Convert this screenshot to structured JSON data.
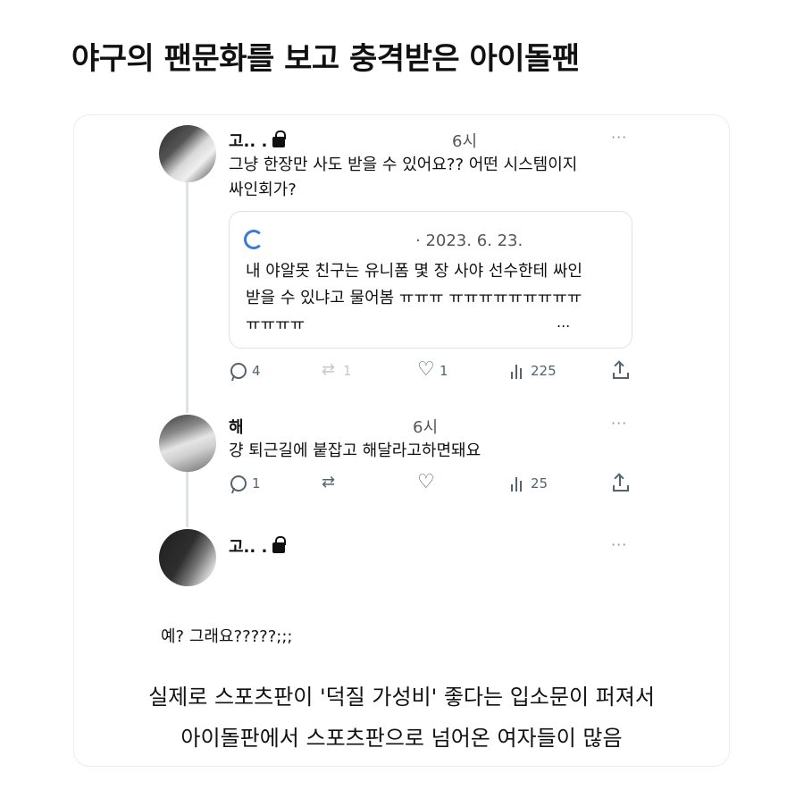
{
  "post": {
    "title": "야구의 팬문화를 보고 충격받은 아이돌팬"
  },
  "tweets": [
    {
      "name": "고.. .",
      "time": "6시",
      "more": "···",
      "text_lines": [
        "그냥 한장만 사도 받을 수 있어요?? 어떤 시스템이지",
        "싸인회가?"
      ],
      "quote": {
        "date": "· 2023. 6. 23.",
        "text_lines": [
          "내 야알못 친구는 유니폼 몇 장 사야 선수한테 싸인",
          "받을 수 있냐고 물어봄 ㅠㅠㅠ ㅠㅠㅠㅠㅠㅠㅠㅠㅠ",
          "ㅠㅠㅠㅠ"
        ],
        "more": "..."
      },
      "actions": {
        "replies": "4",
        "retweets": "1",
        "likes": "1",
        "views": "225"
      }
    },
    {
      "name": "해",
      "time": "6시",
      "more": "···",
      "text_lines": [
        "걍 퇴근길에 붙잡고 해달라고하면돼요"
      ],
      "actions": {
        "replies": "1",
        "retweets": "",
        "likes": "",
        "views": "25"
      }
    },
    {
      "name": "고.. .",
      "more": "···",
      "text_lines": [
        "예? 그래요?????;;;"
      ]
    }
  ],
  "caption_lines": [
    "실제로 스포츠판이 '덕질 가성비' 좋다는 입소문이 퍼져서",
    "아이돌판에서 스포츠판으로 넘어온 여자들이 많음"
  ],
  "colors": {
    "accent": "#3a7bd5",
    "muted": "#536471",
    "line": "#dfe3e6"
  }
}
